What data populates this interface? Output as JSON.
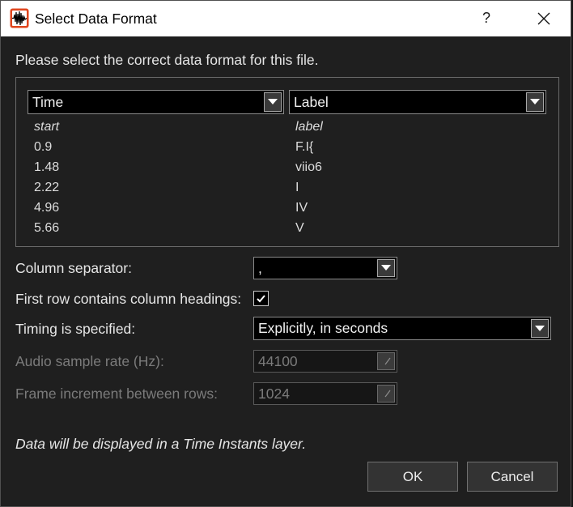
{
  "window": {
    "title": "Select Data Format",
    "help_label": "?",
    "icons": {
      "app": "waveform-icon",
      "close": "close-icon"
    }
  },
  "instructions": "Please select the correct data format for this file.",
  "preview": {
    "column_roles": [
      "Time",
      "Label"
    ],
    "header": [
      "start",
      "label"
    ],
    "rows": [
      [
        "0.9",
        "F.I{"
      ],
      [
        "1.48",
        "viio6"
      ],
      [
        "2.22",
        "I"
      ],
      [
        "4.96",
        "IV"
      ],
      [
        "5.66",
        "V"
      ]
    ]
  },
  "options": {
    "column_separator": {
      "label": "Column separator:",
      "value": ","
    },
    "first_row_headings": {
      "label": "First row contains column headings:",
      "checked": true
    },
    "timing": {
      "label": "Timing is specified:",
      "value": "Explicitly, in seconds"
    },
    "sample_rate": {
      "label": "Audio sample rate (Hz):",
      "value": "44100",
      "enabled": false
    },
    "frame_increment": {
      "label": "Frame increment between rows:",
      "value": "1024",
      "enabled": false
    }
  },
  "summary": "Data will be displayed in a Time Instants layer.",
  "buttons": {
    "ok": "OK",
    "cancel": "Cancel"
  },
  "icons": {
    "dropdown": "chevron-down-icon",
    "checkbox_mark": "check-icon",
    "spin": "spin-button-icon"
  },
  "colors": {
    "title_bar": "#ffffff",
    "body": "#1f1f1f",
    "text": "#e6e6e6",
    "disabled_text": "#7b7b7b",
    "app_icon": "#e0461e"
  }
}
